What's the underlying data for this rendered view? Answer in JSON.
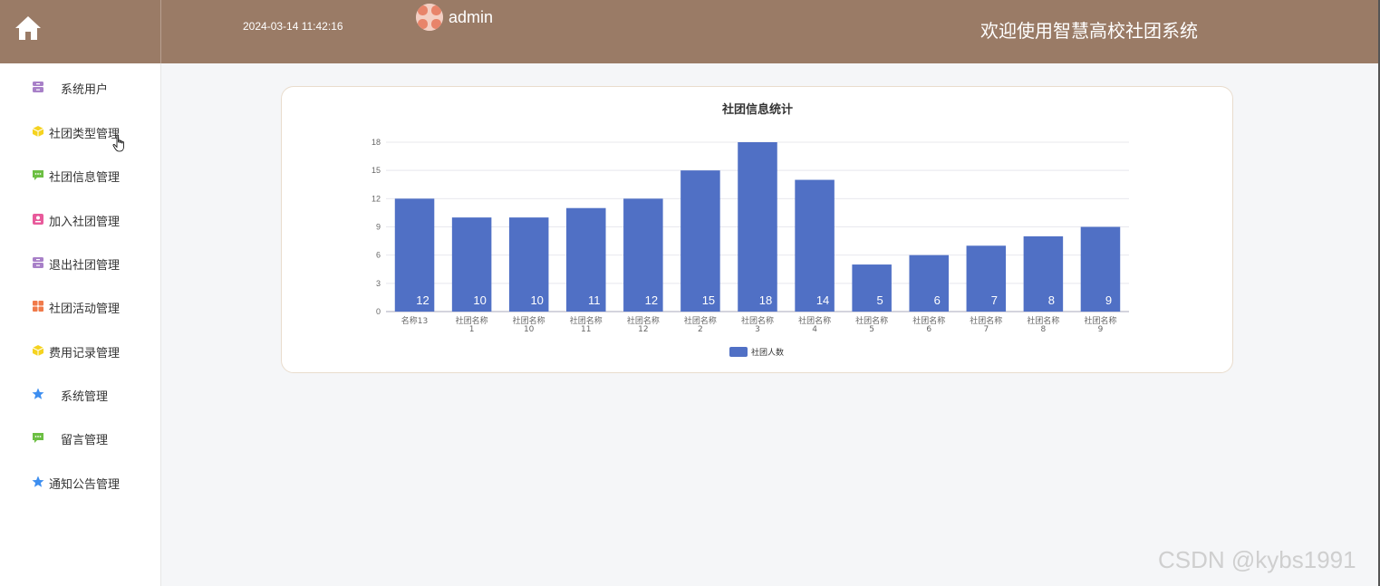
{
  "header": {
    "datetime": "2024-03-14 11:42:16",
    "username": "admin",
    "welcome": "欢迎使用智慧高校社团系统",
    "bg_color": "#9a7b66"
  },
  "sidebar": {
    "items": [
      {
        "label": "系统用户",
        "icon": "archive-icon",
        "color": "#a880c8"
      },
      {
        "label": "社团类型管理",
        "icon": "cube-icon",
        "color": "#f5d320"
      },
      {
        "label": "社团信息管理",
        "icon": "chat-icon",
        "color": "#6cbf43"
      },
      {
        "label": "加入社团管理",
        "icon": "badge-icon",
        "color": "#e85a9b"
      },
      {
        "label": "退出社团管理",
        "icon": "archive-icon",
        "color": "#a880c8"
      },
      {
        "label": "社团活动管理",
        "icon": "grid-icon",
        "color": "#f07a4a"
      },
      {
        "label": "费用记录管理",
        "icon": "cube-icon",
        "color": "#f5d320"
      },
      {
        "label": "系统管理",
        "icon": "star-icon",
        "color": "#3d8ef0"
      },
      {
        "label": "留言管理",
        "icon": "chat-icon",
        "color": "#6cbf43"
      },
      {
        "label": "通知公告管理",
        "icon": "star-icon",
        "color": "#3d8ef0"
      }
    ]
  },
  "chart_data": {
    "type": "bar",
    "title": "社团信息统计",
    "categories": [
      "名称13",
      "社团名称1",
      "社团名称10",
      "社团名称11",
      "社团名称12",
      "社团名称2",
      "社团名称3",
      "社团名称4",
      "社团名称5",
      "社团名称6",
      "社团名称7",
      "社团名称8",
      "社团名称9"
    ],
    "series": [
      {
        "name": "社团人数",
        "values": [
          12,
          10,
          10,
          11,
          12,
          15,
          18,
          14,
          5,
          6,
          7,
          8,
          9
        ],
        "color": "#5070c5"
      }
    ],
    "ylim": [
      0,
      18
    ],
    "yticks": [
      0,
      3,
      6,
      9,
      12,
      15,
      18
    ],
    "grid": true,
    "legend": "bottom"
  },
  "watermark": "CSDN @kybs1991"
}
